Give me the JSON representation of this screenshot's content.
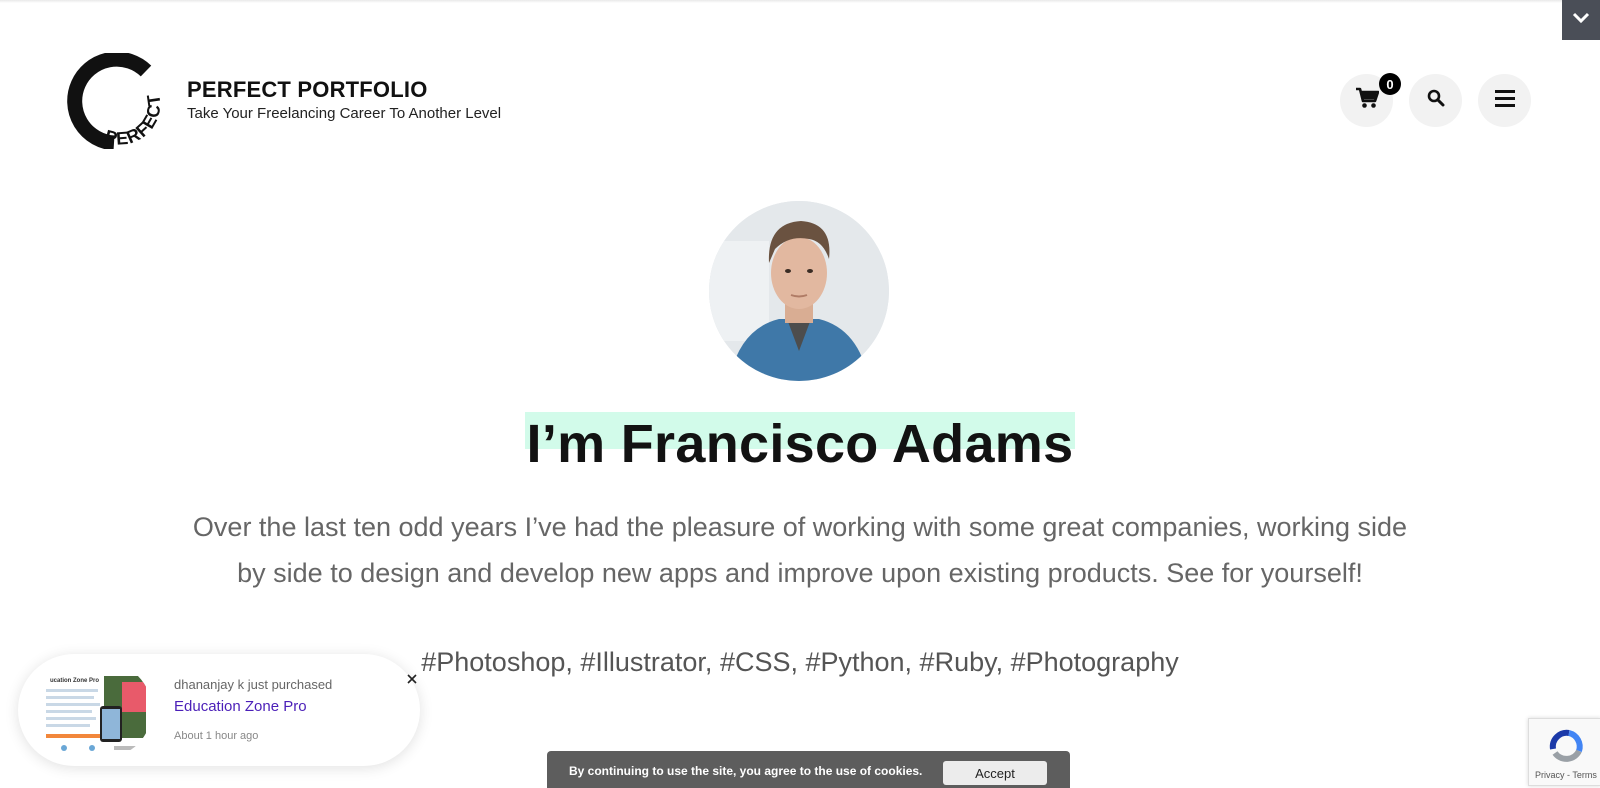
{
  "brand": {
    "logo_text": "PERFECT",
    "title": "PERFECT PORTFOLIO",
    "tagline": "Take Your Freelancing Career To Another Level"
  },
  "header": {
    "cart_count": "0",
    "cart_icon": "cart-icon",
    "search_icon": "search-icon",
    "menu_icon": "hamburger-menu-icon",
    "corner_icon": "chevron-down-icon"
  },
  "hero": {
    "name_heading": "I’m Francisco Adams",
    "description": "Over the last ten odd years I’ve had the pleasure of working with some great companies, working side by side to design and develop new apps and improve upon existing products. See for yourself!",
    "tags": "#Photoshop, #Illustrator, #CSS, #Python, #Ruby, #Photography",
    "highlight_color": "#d2fbea"
  },
  "purchase_popup": {
    "line1": "dhananjay k just purchased",
    "product": "Education Zone Pro",
    "time": "About 1 hour ago",
    "thumb_title": "ucation Zone Pro",
    "close_icon": "close-icon"
  },
  "cookie_bar": {
    "text": "By continuing to use the site, you agree to the use of cookies.",
    "accept_label": "Accept"
  },
  "recaptcha": {
    "terms": "Privacy - Terms"
  },
  "colors": {
    "accent_link": "#4b1fb8",
    "cookie_bg": "#5d5d5d",
    "corner_toggle_bg": "#4a4e57"
  }
}
